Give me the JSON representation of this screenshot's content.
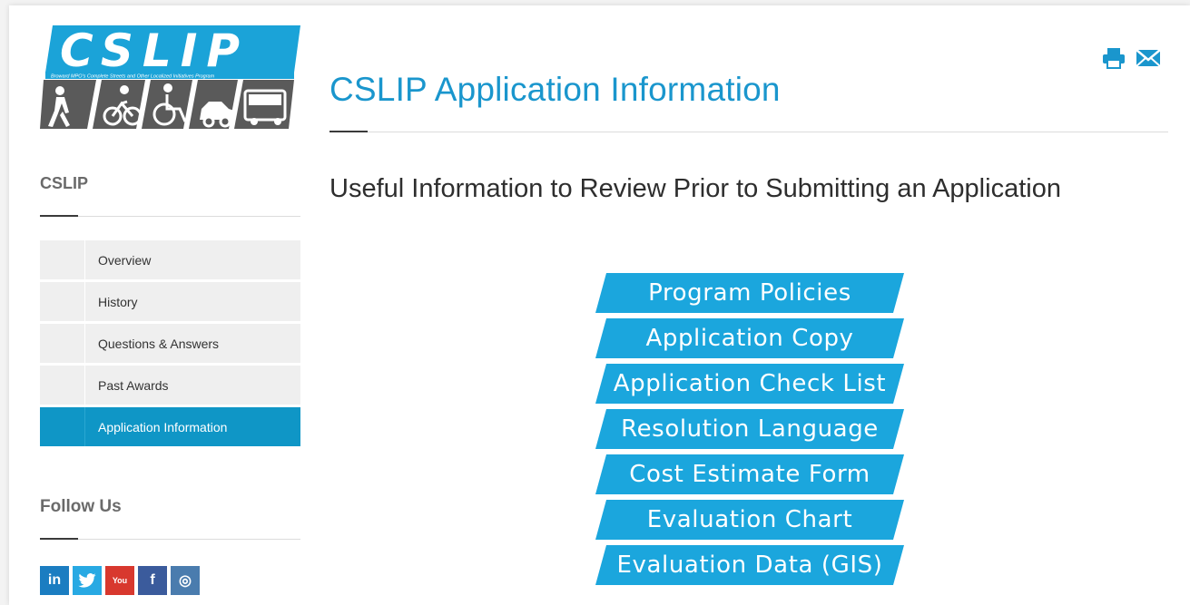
{
  "logo": {
    "wordmark": "CSLIP",
    "tagline": "Broward MPO's Complete Streets and Other Localized Initiatives Program"
  },
  "sidebar": {
    "heading": "CSLIP",
    "items": [
      {
        "label": "Overview",
        "active": false
      },
      {
        "label": "History",
        "active": false
      },
      {
        "label": "Questions & Answers",
        "active": false
      },
      {
        "label": "Past Awards",
        "active": false
      },
      {
        "label": "Application Information",
        "active": true
      }
    ],
    "follow_heading": "Follow Us",
    "social": [
      {
        "name": "linkedin",
        "glyph": "in"
      },
      {
        "name": "twitter",
        "glyph": "t"
      },
      {
        "name": "youtube",
        "glyph": "You"
      },
      {
        "name": "facebook",
        "glyph": "f"
      },
      {
        "name": "instagram",
        "glyph": "◎"
      }
    ]
  },
  "main": {
    "title": "CSLIP Application Information",
    "subtitle": "Useful Information to Review Prior to Submitting an Application",
    "buttons": [
      "Program Policies",
      "Application Copy",
      "Application Check List",
      "Resolution Language",
      "Cost Estimate Form",
      "Evaluation Chart",
      "Evaluation Data (GIS)"
    ]
  },
  "tools": {
    "print_icon": "printer-icon",
    "email_icon": "envelope-icon"
  },
  "colors": {
    "accent": "#1a96cd",
    "button_fill": "#1ba6dd",
    "active_nav": "#0f96c6",
    "logo_dark": "#4a4a4a"
  }
}
